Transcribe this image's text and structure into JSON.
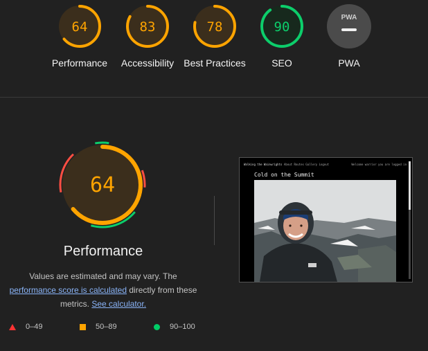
{
  "categories": [
    {
      "id": "performance",
      "score": 64,
      "label": "Performance",
      "color": "#ffa400"
    },
    {
      "id": "accessibility",
      "score": 83,
      "label": "Accessibility",
      "color": "#ffa400"
    },
    {
      "id": "best-practices",
      "score": 78,
      "label": "Best Practices",
      "color": "#ffa400"
    },
    {
      "id": "seo",
      "score": 90,
      "label": "SEO",
      "color": "#0cce6b"
    },
    {
      "id": "pwa",
      "badge": "PWA",
      "label": "PWA",
      "color": "#e0e0e0"
    }
  ],
  "main": {
    "score": 64,
    "title": "Performance",
    "desc_pre": "Values are estimated and may vary. The",
    "desc_link": "performance score is calculated",
    "desc_mid": "directly from these metrics.",
    "desc_calc": "See calculator.",
    "legend": {
      "fail": "0–49",
      "average": "50–89",
      "pass": "90–100"
    }
  },
  "screenshot": {
    "site_name": "Walking the Wainwrights",
    "nav_links": "About  Routes  Gallery  Logout",
    "welcome": "Welcome warrior you are logged in",
    "post_title": "Cold on the Summit"
  },
  "colors": {
    "background": "#212121",
    "fail": "#ff3333",
    "average": "#ffa400",
    "pass": "#00cc66",
    "link": "#8ab4f8"
  }
}
